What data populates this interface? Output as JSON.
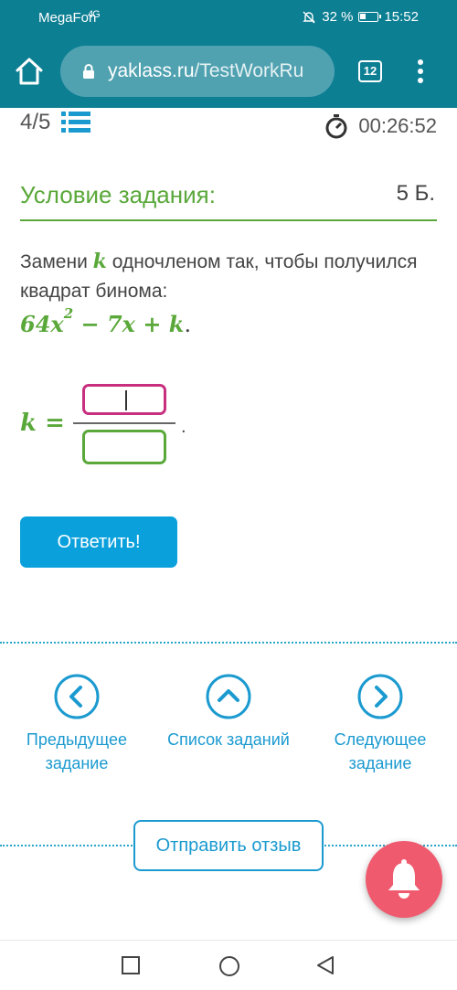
{
  "status_bar": {
    "carrier": "MegaFon",
    "signal": "4G",
    "battery": "32 %",
    "time": "15:52"
  },
  "browser": {
    "url_domain": "yaklass.ru",
    "url_path": "/TestWorkRu",
    "tab_count": "12"
  },
  "test": {
    "progress": "4/5",
    "timer": "00:26:52"
  },
  "task": {
    "section_title": "Условие задания:",
    "points": "5 Б.",
    "text_before": "Замени ",
    "variable": "k",
    "text_after": " одночленом так, чтобы получился квадрат бинома:",
    "expression_coef": "64x",
    "expression_exp": "2",
    "expression_rest": " − 7x + k",
    "expression_end": ".",
    "answer_var": "k =",
    "answer_end": ".",
    "submit_label": "Ответить!"
  },
  "navigation": {
    "prev_label": "Предыдущее задание",
    "list_label": "Список заданий",
    "next_label": "Следующее задание"
  },
  "feedback_label": "Отправить отзыв",
  "colors": {
    "accent_green": "#5aa83a",
    "accent_blue": "#1b9ad0",
    "toolbar_teal": "#0d7f93",
    "button_blue": "#0aa0dc",
    "bell_red": "#f05a6e"
  }
}
